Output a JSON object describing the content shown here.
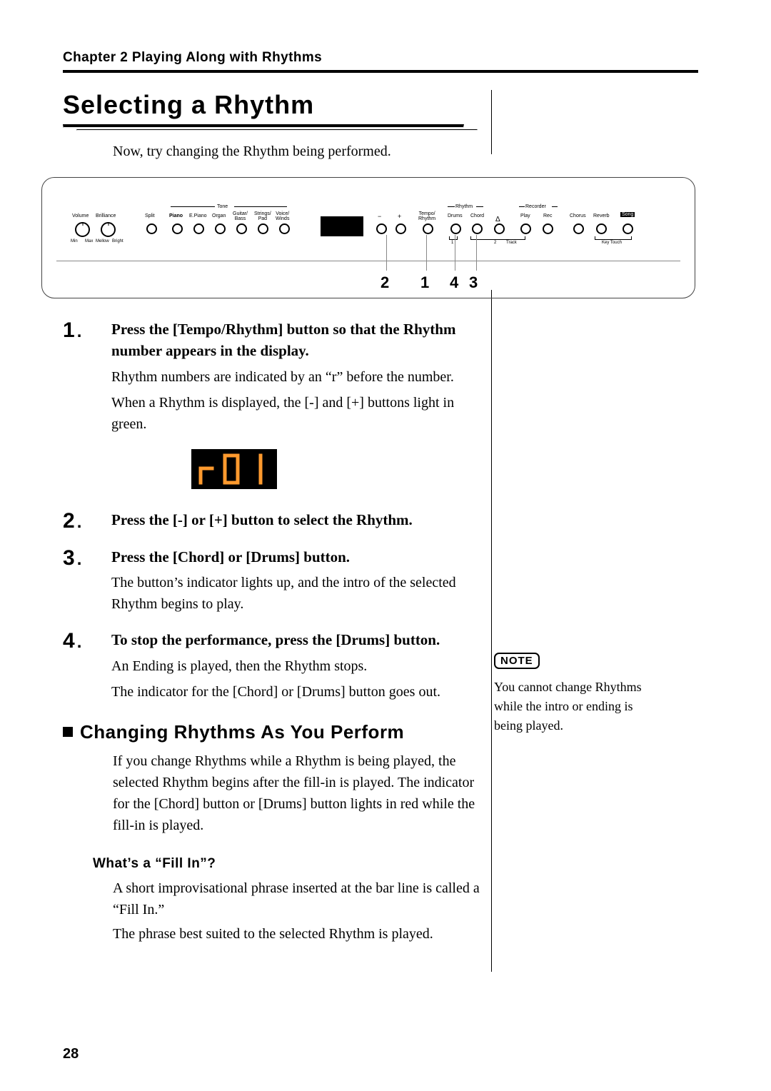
{
  "chapter": "Chapter 2 Playing Along with Rhythms",
  "title": "Selecting a Rhythm",
  "intro": "Now, try changing the Rhythm being performed.",
  "panel": {
    "volume": "Volume",
    "brilliance": "Brilliance",
    "min": "Min",
    "max": "Max",
    "mellow": "Mellow",
    "bright": "Bright",
    "split": "Split",
    "tone_group": "Tone",
    "tones": [
      "Piano",
      "E.Piano",
      "Organ",
      "Guitar/\nBass",
      "Strings/\nPad",
      "Voice/\nWinds"
    ],
    "minus": "−",
    "plus": "+",
    "tempo_rhythm": "Tempo/\nRhythm",
    "rhythm_group": "Rhythm",
    "drums": "Drums",
    "chord": "Chord",
    "metronome": "Δ",
    "recorder_group": "Recorder",
    "play": "Play",
    "rec": "Rec",
    "chorus": "Chorus",
    "reverb": "Reverb",
    "song": "Song",
    "track1": "1",
    "track2": "2",
    "track_label": "Track",
    "keytouch": "Key Touch",
    "callouts": {
      "c1": "1",
      "c2": "2",
      "c3": "3",
      "c4": "4"
    }
  },
  "steps": {
    "s1": {
      "num": "1",
      "lead": "Press the [Tempo/Rhythm] button so that the Rhythm number appears in the display.",
      "p1": "Rhythm numbers are indicated by an “r” before the number.",
      "p2": "When a Rhythm is displayed, the [-] and [+] buttons light in green."
    },
    "display_value": "r 0 1",
    "s2": {
      "num": "2",
      "lead": "Press the [-] or [+] button to select the Rhythm."
    },
    "s3": {
      "num": "3",
      "lead": "Press the [Chord] or [Drums] button.",
      "p1": "The button’s indicator lights up, and the intro of the selected Rhythm begins to play."
    },
    "s4": {
      "num": "4",
      "lead": "To stop the performance, press the [Drums] button.",
      "p1": "An Ending is played, then the Rhythm stops.",
      "p2": "The indicator for the [Chord] or [Drums] button goes out."
    }
  },
  "subsection": {
    "title": "Changing Rhythms As You Perform",
    "para": "If you change Rhythms while a Rhythm is being played, the selected Rhythm begins after the fill-in is played. The indicator for the [Chord] button or [Drums] button lights in red while the fill-in is played."
  },
  "fillin": {
    "heading": "What’s a “Fill In”?",
    "p1": "A short improvisational phrase inserted at the bar line is called a “Fill In.”",
    "p2": "The phrase best suited to the selected Rhythm is played."
  },
  "note_label": "NOTE",
  "note_text": "You cannot change Rhythms while the intro or ending is being played.",
  "page_number": "28"
}
